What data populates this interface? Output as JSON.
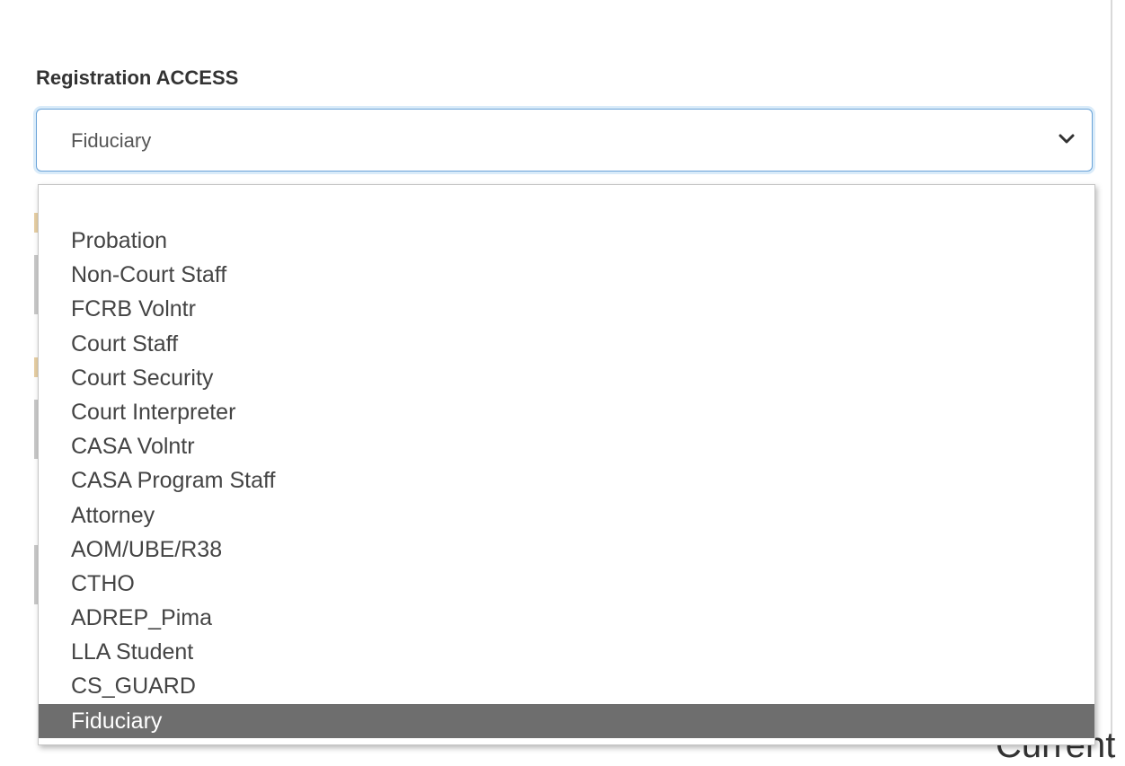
{
  "form": {
    "field_label": "Registration ACCESS",
    "select": {
      "selected_value": "Fiduciary",
      "icon": "chevron-down-icon"
    }
  },
  "dropdown": {
    "options": [
      "Probation",
      "Non-Court Staff",
      "FCRB Volntr",
      "Court Staff",
      "Court Security",
      "Court Interpreter",
      "CASA Volntr",
      "CASA Program Staff",
      "Attorney",
      "AOM/UBE/R38",
      "CTHO",
      "ADREP_Pima",
      "LLA Student",
      "CS_GUARD",
      "Fiduciary"
    ],
    "highlighted_option": "Fiduciary"
  },
  "background": {
    "partial_text": "Current"
  },
  "colors": {
    "focus_border": "#6aa3d8",
    "highlight_bg": "#6e6e6e",
    "highlight_text": "#ffffff"
  }
}
